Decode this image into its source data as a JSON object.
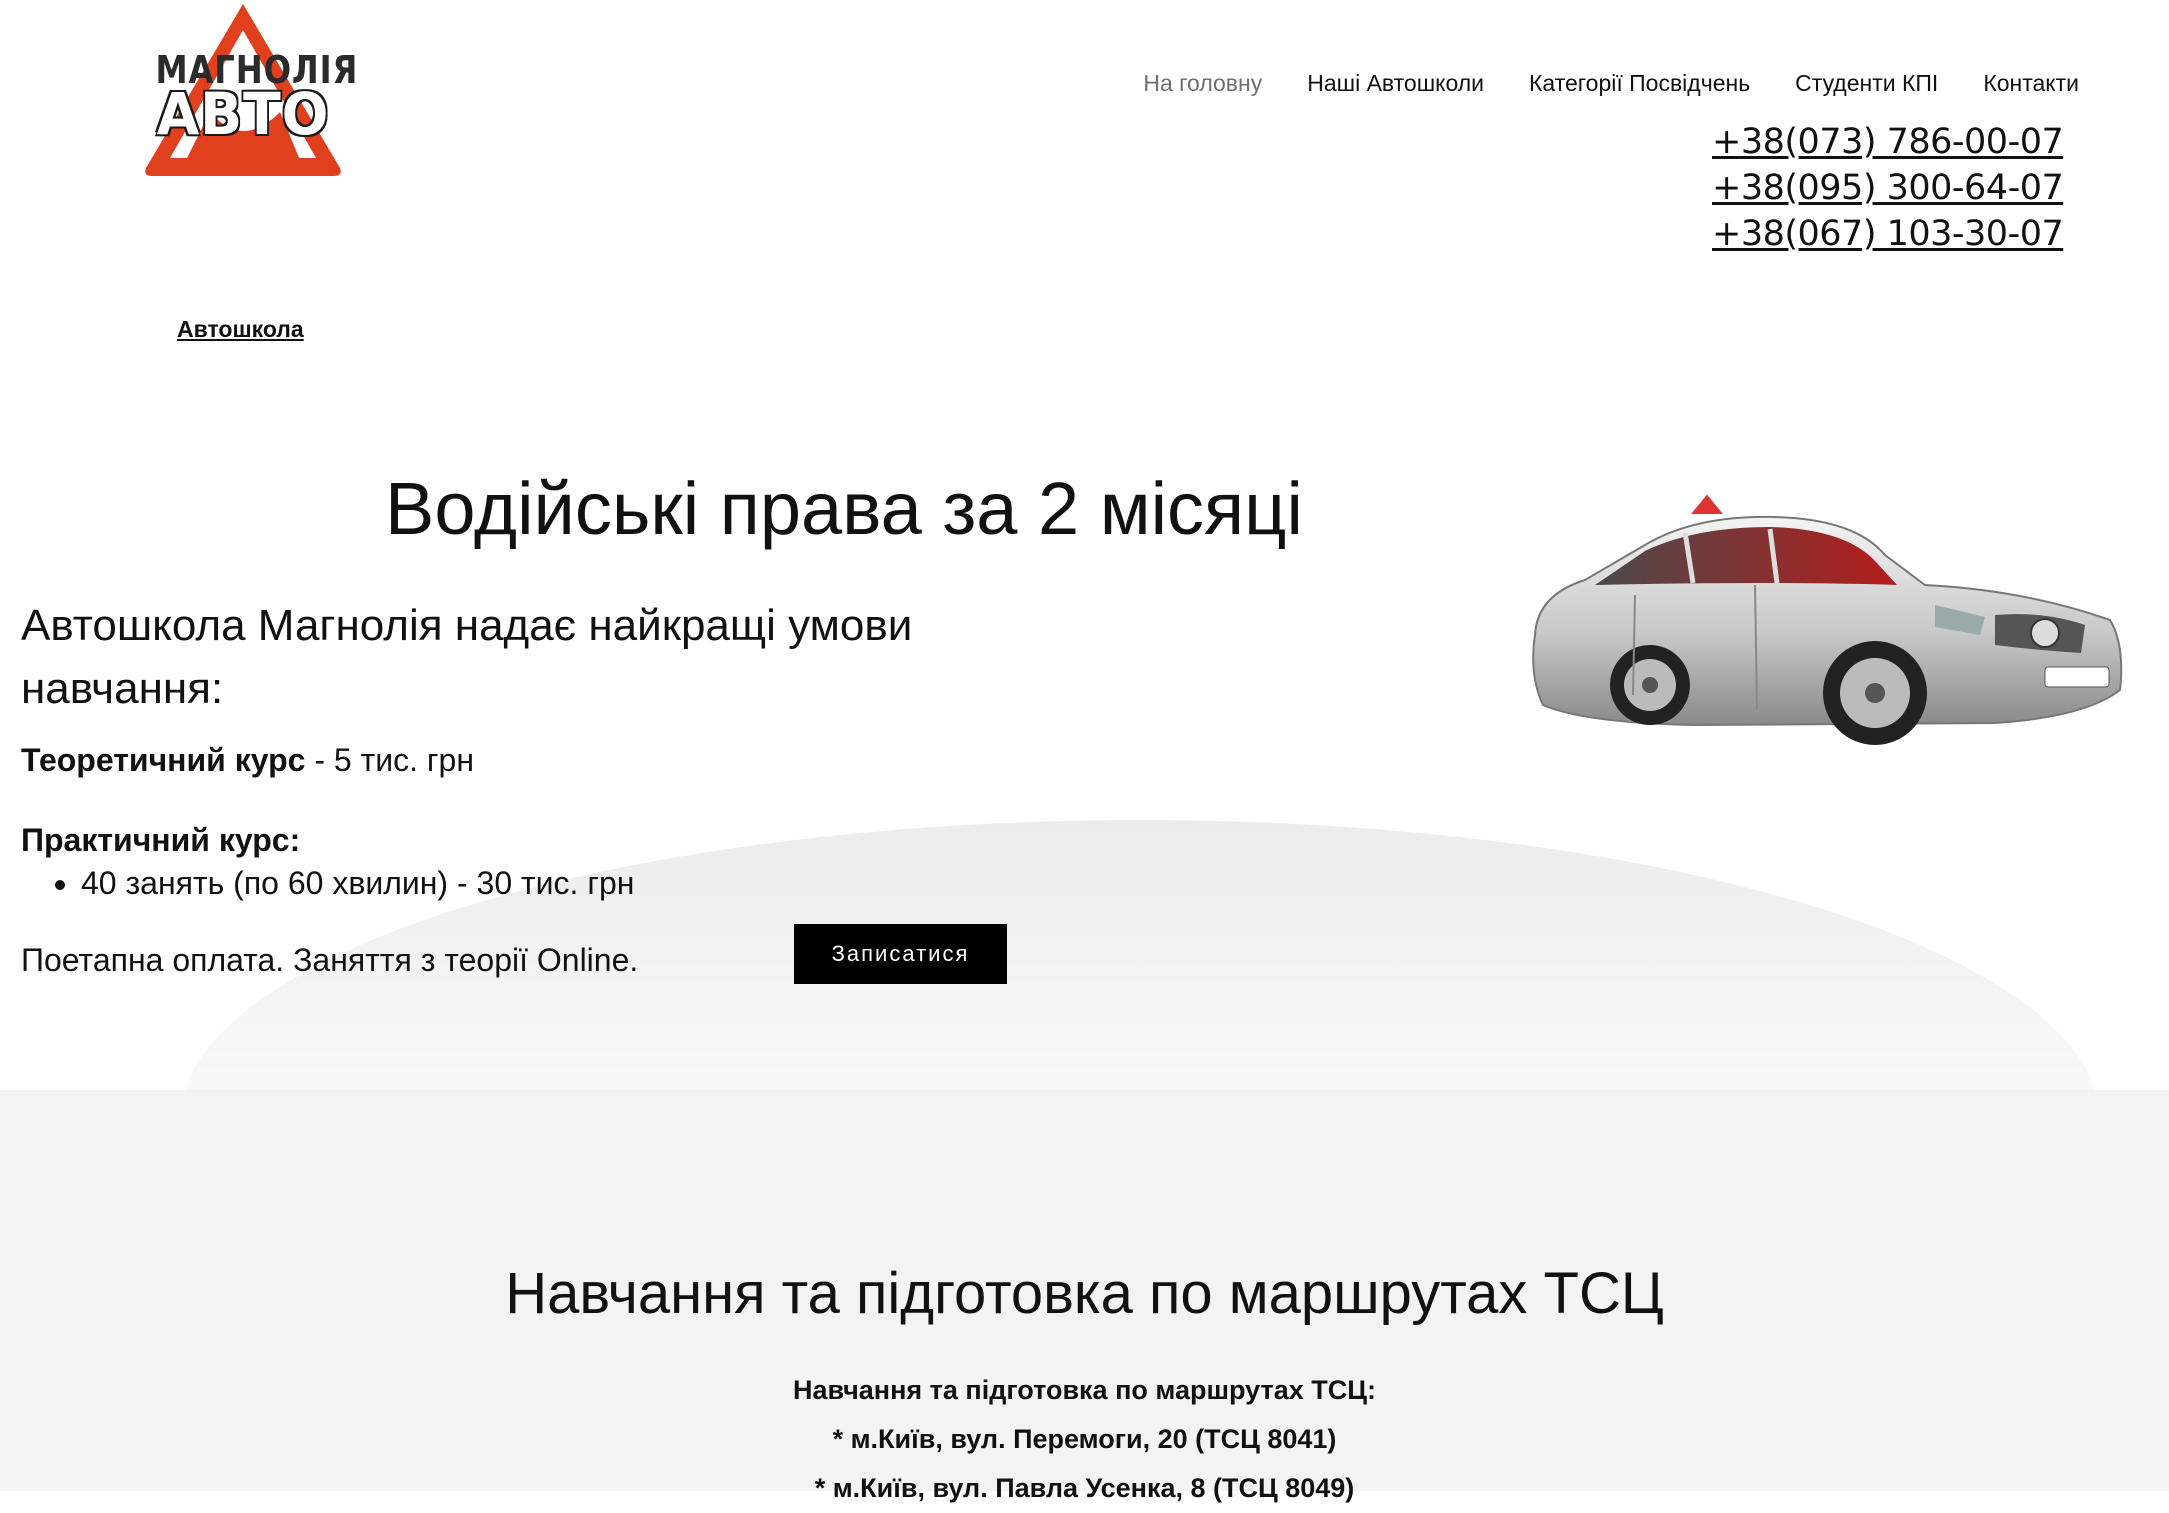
{
  "header": {
    "logo": {
      "line1": "МАГНОЛІЯ",
      "line2": "АВТО",
      "colors": {
        "triangle": "#e0401e",
        "text_dark": "#2b2b2b"
      }
    },
    "nav": [
      {
        "label": "На головну",
        "active": true
      },
      {
        "label": "Наші Автошколи"
      },
      {
        "label": "Категорії Посвідчень"
      },
      {
        "label": "Студенти КПІ"
      },
      {
        "label": "Контакти"
      }
    ],
    "phones": [
      "+38(073) 786-00-07",
      "+38(095) 300-64-07",
      "+38(067) 103-30-07"
    ]
  },
  "breadcrumb": "Автошкола",
  "hero": {
    "title": "Водійські права за 2 місяці",
    "subtitle": "Автошкола Магнолія надає найкращі умови навчання:",
    "theory": {
      "label": "Теоретичний курс",
      "value": " - 5 тис. грн"
    },
    "practice": {
      "label": "Практичний курс:",
      "items": [
        "40 занять (по 60 хвилин) - 30 тис. грн"
      ]
    },
    "payment": "Поетапна оплата. Заняття з теорії Online.",
    "cta_label": "Записатися",
    "image": "car-icon"
  },
  "routes": {
    "title": "Навчання та підготовка по маршрутах ТСЦ",
    "lines": [
      "Навчання та підготовка по маршрутах ТСЦ:",
      "* м.Київ, вул. Перемоги, 20 (ТСЦ 8041)",
      "* м.Київ, вул. Павла Усенка, 8 (ТСЦ 8049)"
    ]
  }
}
